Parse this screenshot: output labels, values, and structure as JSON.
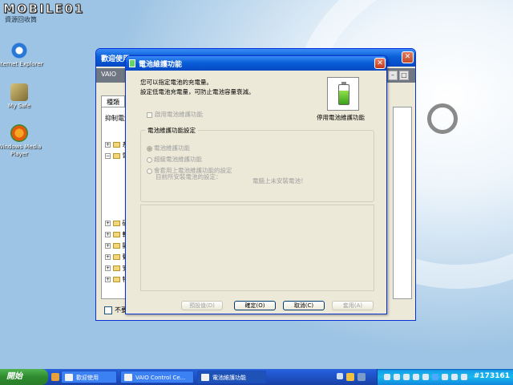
{
  "watermark": {
    "logo": "MOBILE01",
    "sub": "資源回收筒"
  },
  "desktop_icons": [
    {
      "label": "Internet Explorer"
    },
    {
      "label": "My Safe"
    },
    {
      "label": "Windows Media Player"
    }
  ],
  "back_window": {
    "title": "歡迎使用",
    "vaio_bar": "VAIO",
    "tab": "種類",
    "panel_header": "抑制電池",
    "tree": [
      "系",
      "電",
      "硬",
      "軟",
      "顯",
      "聲",
      "安",
      "特"
    ],
    "bottom_checkbox": "不要"
  },
  "dialog": {
    "title": "電池維護功能",
    "line1": "您可以指定電池的充電量。",
    "line2": "設定低電池充電量，可防止電池容量衰減。",
    "battery_label": "停用電池維護功能",
    "enable_checkbox": "啟用電池維護功能",
    "group_title": "電池維護功能設定",
    "radio1": "電池維護功能",
    "radio2": "超級電池維護功能",
    "radio3_line1": "會套用上電池維護功能的設定",
    "radio3_line2": "目前所安裝電池的設定：",
    "no_battery": "電腦上未安裝電池！",
    "buttons": {
      "defaults": "預設值(D)",
      "ok": "確定(O)",
      "cancel": "取消(C)",
      "apply": "套用(A)"
    }
  },
  "taskbar": {
    "start": "開始",
    "tasks": [
      "歡迎使用",
      "VAIO Control Ce...",
      "電池維護功能"
    ],
    "clock": "#173161"
  },
  "colors": {
    "accent": "#0a5fd9",
    "taskbar": "#245edb",
    "start": "#2e8b2e"
  }
}
